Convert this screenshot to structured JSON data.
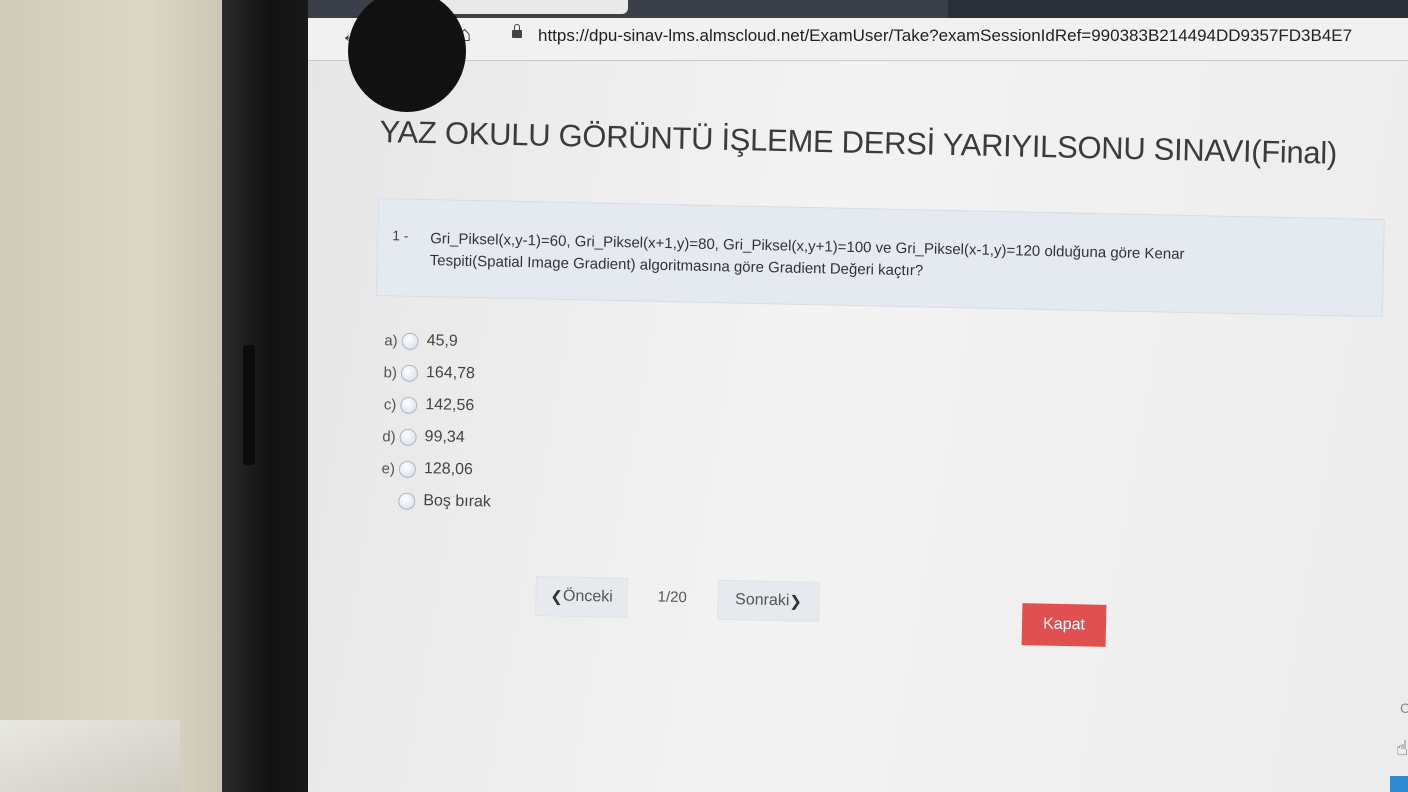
{
  "browser": {
    "url": "https://dpu-sinav-lms.almscloud.net/ExamUser/Take?examSessionIdRef=990383B214494DD9357FD3B4E7"
  },
  "exam": {
    "title": "YAZ OKULU GÖRÜNTÜ İŞLEME DERSİ YARIYILSONU SINAVI(Final)"
  },
  "question": {
    "number": "1 -",
    "line1": "Gri_Piksel(x,y-1)=60, Gri_Piksel(x+1,y)=80, Gri_Piksel(x,y+1)=100 ve Gri_Piksel(x-1,y)=120 olduğuna göre Kenar",
    "line2": "Tespiti(Spatial Image Gradient) algoritmasına göre Gradient Değeri kaçtır?"
  },
  "options": [
    {
      "letter": "a)",
      "value": "45,9"
    },
    {
      "letter": "b)",
      "value": "164,78"
    },
    {
      "letter": "c)",
      "value": "142,56"
    },
    {
      "letter": "d)",
      "value": "99,34"
    },
    {
      "letter": "e)",
      "value": "128,06"
    },
    {
      "letter": "",
      "value": "Boş bırak"
    }
  ],
  "pager": {
    "prev_label": "Önceki",
    "position": "1/20",
    "next_label": "Sonraki"
  },
  "close_label": "Kapat",
  "edge_glyph": "C",
  "colors": {
    "close_button": "#e05050",
    "question_bg": "#e5eaf1"
  }
}
